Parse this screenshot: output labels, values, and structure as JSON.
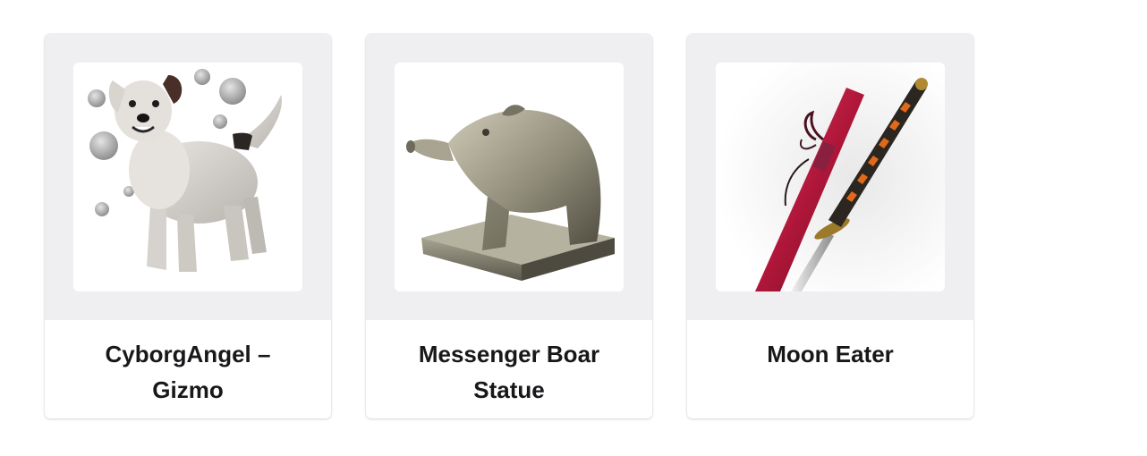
{
  "items": [
    {
      "title": "CyborgAngel – Gizmo",
      "icon": "dog-icon"
    },
    {
      "title": "Messenger Boar Statue",
      "icon": "boar-statue-icon"
    },
    {
      "title": "Moon Eater",
      "icon": "katana-icon"
    }
  ],
  "colors": {
    "card_media_bg": "#efeff1",
    "title_text": "#18181b",
    "katana_sheath": "#b0173a"
  }
}
